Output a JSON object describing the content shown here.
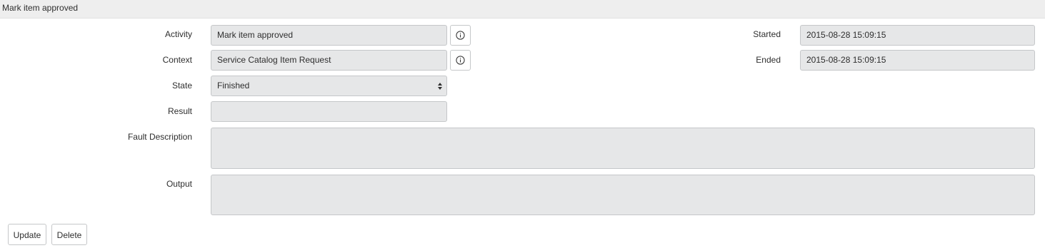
{
  "header": {
    "title": "Mark item approved"
  },
  "form": {
    "activity": {
      "label": "Activity",
      "value": "Mark item approved"
    },
    "context": {
      "label": "Context",
      "value": "Service Catalog Item Request"
    },
    "state": {
      "label": "State",
      "value": "Finished"
    },
    "result": {
      "label": "Result",
      "value": ""
    },
    "fault_description": {
      "label": "Fault Description",
      "value": ""
    },
    "output": {
      "label": "Output",
      "value": ""
    },
    "started": {
      "label": "Started",
      "value": "2015-08-28 15:09:15"
    },
    "ended": {
      "label": "Ended",
      "value": "2015-08-28 15:09:15"
    }
  },
  "icons": {
    "info": "info-icon",
    "select_arrows": "sort-arrows-icon"
  },
  "actions": {
    "update_label": "Update",
    "delete_label": "Delete"
  }
}
